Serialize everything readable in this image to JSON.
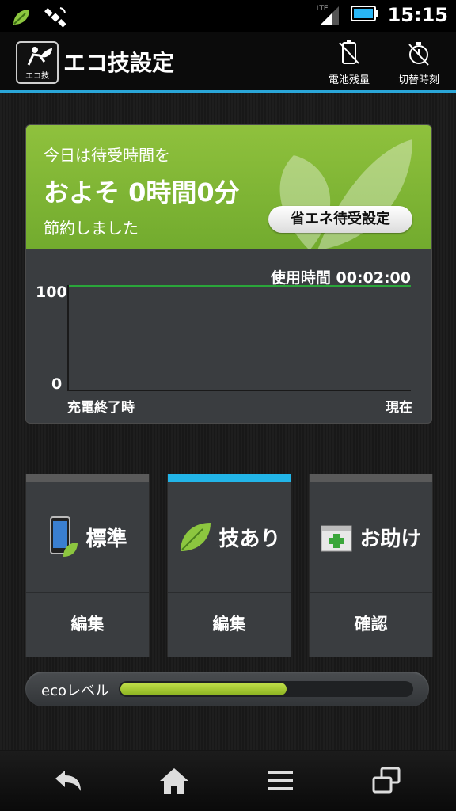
{
  "status_bar": {
    "time": "15:15",
    "network": "LTE"
  },
  "app_bar": {
    "icon_label": "エコ技",
    "title": "エコ技設定",
    "actions": [
      {
        "label": "電池残量",
        "icon": "battery-strike-icon"
      },
      {
        "label": "切替時刻",
        "icon": "timer-strike-icon"
      }
    ]
  },
  "summary_card": {
    "line1": "今日は待受時間を",
    "line2": "およそ 0時間0分",
    "line3": "節約しました",
    "button_label": "省エネ待受設定",
    "colors": {
      "green_top": "#8fc13d",
      "green_bottom": "#72ab2e"
    }
  },
  "chart_data": {
    "type": "line",
    "usage_label": "使用時間 00:02:00",
    "y_ticks": [
      "100",
      "0"
    ],
    "ylim": [
      0,
      100
    ],
    "x_labels": [
      "充電終了時",
      "現在"
    ],
    "series": [
      {
        "values": [
          100,
          100
        ]
      }
    ],
    "line_color": "#2aa63a"
  },
  "modes": [
    {
      "label": "標準",
      "action": "編集",
      "icon": "phone-leaf-icon",
      "selected": false
    },
    {
      "label": "技あり",
      "action": "編集",
      "icon": "leaf-icon",
      "selected": true
    },
    {
      "label": "お助け",
      "action": "確認",
      "icon": "first-aid-box-icon",
      "selected": false
    }
  ],
  "eco_level": {
    "label": "ecoレベル",
    "fraction": 0.57
  },
  "nav": [
    "back-icon",
    "home-icon",
    "menu-icon",
    "recent-apps-icon"
  ],
  "accent": "#22b5e8"
}
